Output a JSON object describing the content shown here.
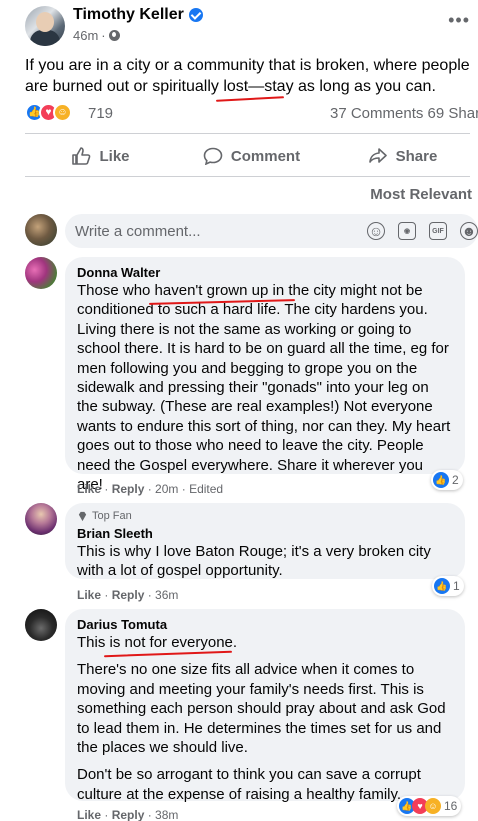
{
  "post": {
    "author": "Timothy Keller",
    "time": "46m",
    "text": "If you are in a city or a community that is broken, where people are burned out or spiritually lost—stay as long as you can.",
    "reaction_count": "719",
    "comments_shares": "37 Comments  69 Shar",
    "accent_color": "#1877f2"
  },
  "actions": {
    "like": "Like",
    "comment": "Comment",
    "share": "Share"
  },
  "sort_label": "Most Relevant",
  "composer": {
    "placeholder": "Write a comment..."
  },
  "comments": [
    {
      "name": "Donna Walter",
      "text": "Those who haven't grown up in the city might not be conditioned to such a hard life. The city hardens you. Living there is not the same as working or going to school there. It is hard to be on guard all the time, eg for men following you and begging to grope you on the sidewalk and pressing their \"gonads\" into your leg on the subway. (These are real examples!) Not everyone wants to endure this sort of thing, nor can they. My heart goes out to those who need to leave the city. People need the Gospel everywhere. Share it wherever you are!",
      "like": "Like",
      "reply": "Reply",
      "time": "20m",
      "edited": "Edited",
      "reactions": "2"
    },
    {
      "badge": "Top Fan",
      "name": "Brian Sleeth",
      "text": "This is why I love Baton Rouge; it's a very broken city with a lot of gospel opportunity.",
      "like": "Like",
      "reply": "Reply",
      "time": "36m",
      "reactions": "1"
    },
    {
      "name": "Darius Tomuta",
      "paragraphs": [
        "This is not for everyone.",
        "There's no one size fits all advice when it comes to moving and meeting your family's needs first. This is something each person should pray about and ask God to lead them in. He determines the times set for us and the places we should live.",
        "Don't be so arrogant to think you can save a corrupt culture at the expense of raising a healthy family."
      ],
      "like": "Like",
      "reply": "Reply",
      "time": "38m",
      "reactions": "16"
    }
  ],
  "icons": {
    "post_more": "more-dots-icon",
    "verified": "verified-badge-icon",
    "audience": "globe-icon",
    "composer": [
      "emoji-icon",
      "camera-icon",
      "gif-icon",
      "sticker-icon"
    ]
  }
}
